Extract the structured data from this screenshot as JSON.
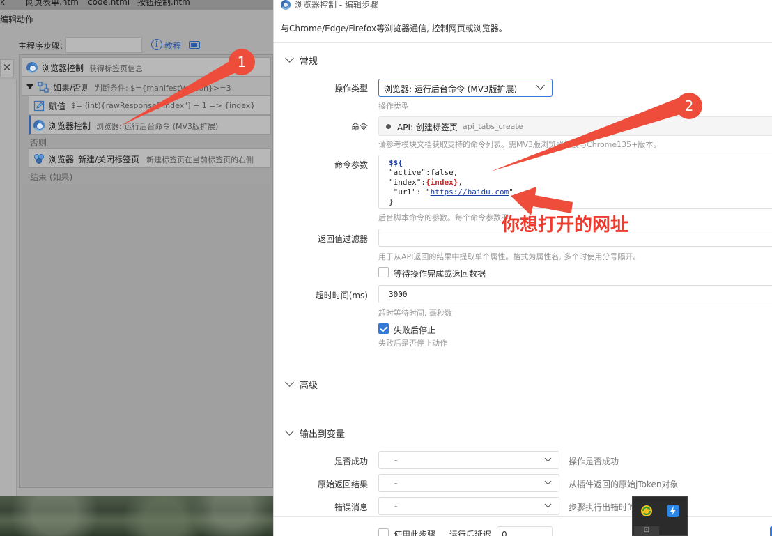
{
  "left": {
    "tabs": [
      "k",
      "网页表单.htm",
      "code.html",
      "按钮控制.htm"
    ],
    "title": "编辑动作",
    "main_step_label": "主程序步骤:",
    "tutorial_label": "教程",
    "close_glyph": "✕",
    "steps": [
      {
        "name": "浏览器控制",
        "desc": "获得标签页信息"
      },
      {
        "name": "如果/否则",
        "desc": "判断条件: $={manifestVersion}>=3"
      },
      {
        "name": "赋值",
        "desc": "$= (int){rawResponse[\"index\"] + 1 => {index}"
      },
      {
        "name": "浏览器控制",
        "desc": "浏览器: 运行后台命令 (MV3版扩展)"
      },
      {
        "name": "浏览器_新建/关闭标签页",
        "desc": "新建标签页在当前标签页的右侧"
      }
    ],
    "else_label": "否则",
    "end_label": "结束 (如果)"
  },
  "dialog": {
    "title": "浏览器控制  -  编辑步骤",
    "description": "与Chrome/Edge/Firefox等浏览器通信, 控制网页或浏览器。",
    "sections": {
      "general": "常规",
      "advanced": "高级",
      "output": "输出到变量"
    },
    "op_type": {
      "label": "操作类型",
      "value": "浏览器: 运行后台命令 (MV3版扩展)",
      "hint": "操作类型"
    },
    "command": {
      "label": "命令",
      "name": "API: 创建标签页",
      "code": "api_tabs_create",
      "hint": "请参考模块文档获取支持的命令列表。需MV3版浏览器扩展与Chrome135+版本。"
    },
    "params": {
      "label": "命令参数",
      "line1": "$${",
      "line2": "\"active\":false,",
      "line3_key": "\"index\":",
      "line3_var": "{index}",
      "line3_end": ",",
      "line4_key": " \"url\": \"",
      "line4_url": "https://baidu.com",
      "line4_end": "\"",
      "line5": "}",
      "hint": "后台脚本命令的参数。每个命令参数不"
    },
    "filter": {
      "label": "返回值过滤器",
      "value": "",
      "hint": "用于从API返回的结果中提取单个属性。格式为属性名, 多个时使用分号隔开。"
    },
    "wait": {
      "label": "等待操作完成或返回数据",
      "checked": false
    },
    "timeout": {
      "label": "超时时间(ms)",
      "value": "3000",
      "hint": "超时等待时间, 毫秒数"
    },
    "stop_on_fail": {
      "label": "失败后停止",
      "checked": true,
      "hint": "失败后是否停止动作"
    },
    "outputs": [
      {
        "label": "是否成功",
        "value": "-",
        "hint": "操作是否成功"
      },
      {
        "label": "原始返回结果",
        "value": "-",
        "hint": "从插件返回的原始jToken对象"
      },
      {
        "label": "错误消息",
        "value": "-",
        "hint": "步骤执行出错时的"
      }
    ],
    "footer": {
      "use_step_label": "使用此步骤",
      "delay_label": "运行后延迟",
      "delay_value": "0"
    }
  },
  "annotations": {
    "badge1": "1",
    "badge2": "2",
    "note": "你想打开的网址",
    "color": "#ee4d3c"
  },
  "tray": {
    "slot_label": "⊡"
  }
}
